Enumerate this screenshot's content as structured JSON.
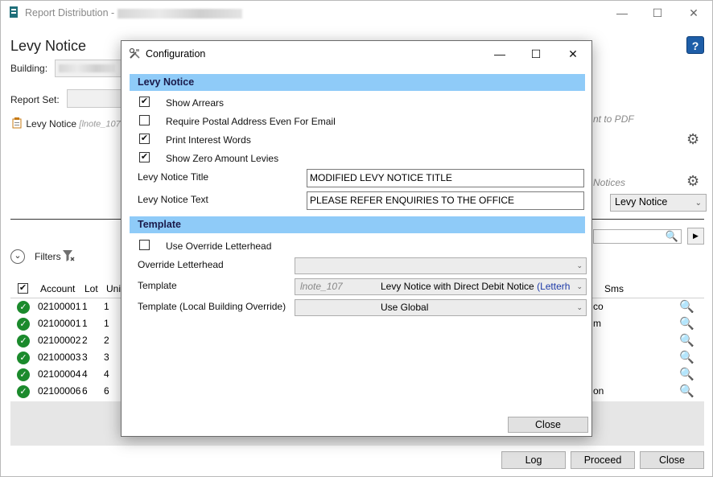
{
  "app": {
    "title": "Report Distribution",
    "heading": "Levy Notice",
    "building_label": "Building:",
    "report_set_label": "Report Set:",
    "report_item_label": "Levy Notice",
    "report_item_code": "[lnote_107",
    "pdf_hint": "nt to PDF",
    "notices_hint": "Notices",
    "levy_notice_select": "Levy Notice",
    "filters_label": "Filters",
    "help_label": "?"
  },
  "window_controls": {
    "minimize": "—",
    "maximize": "☐",
    "close": "✕"
  },
  "grid": {
    "columns": [
      "Account",
      "Lot",
      "Unit",
      "Sms"
    ],
    "rows": [
      {
        "account": "02100001",
        "lot": "1",
        "unit": "1",
        "sms": "co"
      },
      {
        "account": "02100001",
        "lot": "1",
        "unit": "1",
        "sms": "m"
      },
      {
        "account": "02100002",
        "lot": "2",
        "unit": "2",
        "sms": ""
      },
      {
        "account": "02100003",
        "lot": "3",
        "unit": "3",
        "sms": ""
      },
      {
        "account": "02100004",
        "lot": "4",
        "unit": "4",
        "sms": ""
      },
      {
        "account": "02100006",
        "lot": "6",
        "unit": "6",
        "sms": "on"
      }
    ]
  },
  "footer": {
    "log": "Log",
    "proceed": "Proceed",
    "close": "Close"
  },
  "dialog": {
    "title": "Configuration",
    "levy_section": "Levy Notice",
    "options": [
      {
        "label": "Show Arrears",
        "checked": true
      },
      {
        "label": "Require Postal Address Even For Email",
        "checked": false
      },
      {
        "label": "Print Interest Words",
        "checked": true
      },
      {
        "label": "Show Zero Amount Levies",
        "checked": true
      }
    ],
    "levy_title_label": "Levy Notice Title",
    "levy_title_value": "MODIFIED LEVY NOTICE TITLE",
    "levy_text_label": "Levy Notice Text",
    "levy_text_value": "PLEASE REFER ENQUIRIES TO THE OFFICE",
    "template_section": "Template",
    "use_override_label": "Use Override Letterhead",
    "use_override_checked": false,
    "override_letterhead_label": "Override Letterhead",
    "override_letterhead_value": "",
    "template_label": "Template",
    "template_code": "lnote_107",
    "template_value": "Levy Notice with Direct Debit Notice",
    "template_suffix": "(Letterh",
    "template_local_label": "Template (Local Building Override)",
    "template_local_value": "Use Global",
    "close_button": "Close"
  }
}
